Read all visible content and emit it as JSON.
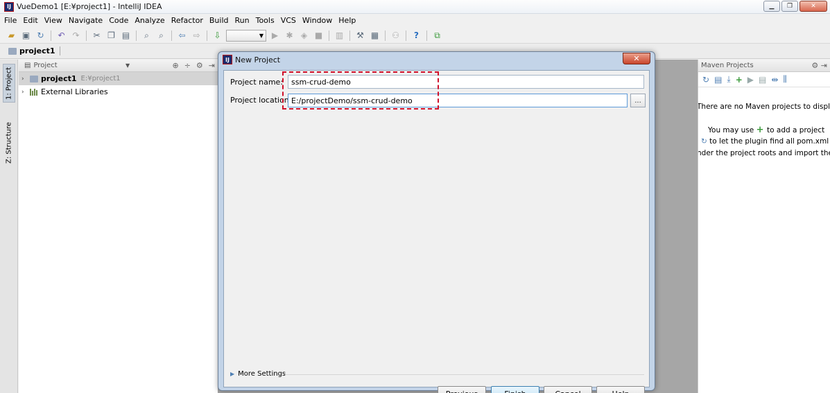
{
  "window": {
    "title": "VueDemo1 [E:¥project1] - IntelliJ IDEA",
    "controls": [
      "minimize",
      "restore",
      "close"
    ]
  },
  "menu": [
    "File",
    "Edit",
    "View",
    "Navigate",
    "Code",
    "Analyze",
    "Refactor",
    "Build",
    "Run",
    "Tools",
    "VCS",
    "Window",
    "Help"
  ],
  "toolbar": {
    "icons": [
      "open-folder-icon",
      "save-icon",
      "sync-icon",
      "undo-icon",
      "redo-icon",
      "cut-icon",
      "copy-icon",
      "paste-icon",
      "find-icon",
      "replace-icon",
      "back-icon",
      "forward-icon",
      "build-icon",
      "run-config-combo",
      "run-icon",
      "debug-icon",
      "coverage-icon",
      "stop-icon",
      "vcs-icon",
      "settings-icon",
      "project-structure-icon",
      "sdk-icon",
      "help-icon",
      "plugin-icon"
    ]
  },
  "navbar": {
    "crumb": "project1"
  },
  "leftstrip": {
    "tabs": [
      {
        "label": "1: Project",
        "active": true
      },
      {
        "label": "Z: Structure",
        "active": false
      }
    ]
  },
  "project_panel": {
    "header": "Project",
    "tree": [
      {
        "label": "project1",
        "path": "E:¥project1",
        "selected": true,
        "bold": true
      },
      {
        "label": "External Libraries",
        "path": "",
        "selected": false,
        "bold": false
      }
    ]
  },
  "maven_panel": {
    "header": "Maven Projects",
    "lines": [
      "There are no Maven projects to displa",
      "You may use",
      "to add a project",
      "to let the plugin find all pom.xml",
      "nder the project roots and import the"
    ]
  },
  "dialog": {
    "title": "New Project",
    "project_name_label": "Project name:",
    "project_name_value": "ssm-crud-demo",
    "project_location_label": "Project location:",
    "project_location_value": "E:/projectDemo/ssm-crud-demo",
    "browse_label": "...",
    "more_settings": "More Settings",
    "buttons": {
      "previous": "Previous",
      "finish": "Finish",
      "cancel": "Cancel",
      "help": "Help"
    }
  },
  "colors": {
    "highlight": "#d0102a",
    "selection": "#d4d4d4",
    "dialog_frame": "#c3d4e8"
  }
}
